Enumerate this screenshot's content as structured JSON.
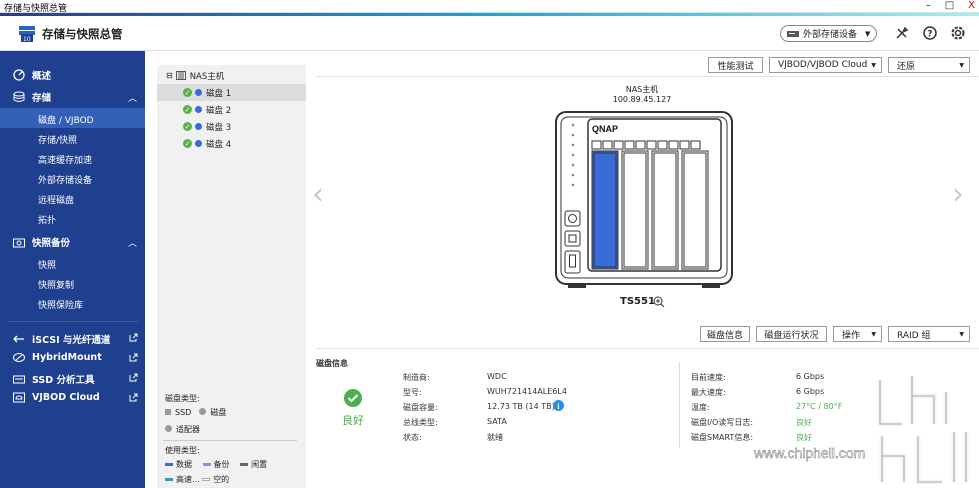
{
  "window": {
    "title": "存储与快照总管",
    "min": "–",
    "max": "□",
    "close": "X"
  },
  "header": {
    "title": "存储与快照总管",
    "ext_btn": "外部存储设备"
  },
  "sidebar": {
    "overview": "概述",
    "storage": "存储",
    "storage_items": [
      "磁盘 / VJBOD",
      "存储/快照",
      "高速缓存加速",
      "外部存储设备",
      "远程磁盘",
      "拓扑"
    ],
    "backup": "快照备份",
    "backup_items": [
      "快照",
      "快照复制",
      "快照保险库"
    ],
    "links": [
      "iSCSI 与光纤通道",
      "HybridMount",
      "SSD 分析工具",
      "VJBOD Cloud"
    ]
  },
  "tree": {
    "root": "NAS主机",
    "disks": [
      "磁盘 1",
      "磁盘 2",
      "磁盘 3",
      "磁盘 4"
    ]
  },
  "legend": {
    "disk_type_title": "磁盘类型:",
    "ssd": "SSD",
    "disk": "磁盘",
    "adapter": "适配器",
    "usage_title": "使用类型:",
    "data": "数据",
    "backup": "备份",
    "idle": "闲置",
    "cache": "高速...",
    "empty": "空的"
  },
  "toolbar": {
    "perf": "性能测试",
    "vjbod": "VJBOD/VJBOD Cloud",
    "restore": "还原"
  },
  "nas": {
    "name": "NAS主机",
    "ip": "100.89.45.127",
    "brand": "QNAP",
    "model": "TS551"
  },
  "actions": {
    "disk_info": "磁盘信息",
    "disk_status": "磁盘运行状况",
    "op": "操作",
    "raid": "RAID 组"
  },
  "disk_info": {
    "title": "磁盘信息",
    "health": "良好",
    "left": [
      {
        "label": "制造商:",
        "value": "WDC"
      },
      {
        "label": "型号:",
        "value": "WUH721414ALE6L4"
      },
      {
        "label": "磁盘容量:",
        "value": "12.73 TB (14 TB)"
      },
      {
        "label": "总线类型:",
        "value": "SATA"
      },
      {
        "label": "状态:",
        "value": "就绪"
      }
    ],
    "right": [
      {
        "label": "目前速度:",
        "value": "6 Gbps"
      },
      {
        "label": "最大速度:",
        "value": "6 Gbps"
      },
      {
        "label": "温度:",
        "value": "27°C / 80°F"
      },
      {
        "label": "磁盘I/O读写日志:",
        "value": "良好"
      },
      {
        "label": "磁盘SMART信息:",
        "value": "良好"
      }
    ]
  },
  "watermark": {
    "url": "www.chiphell.com"
  },
  "colors": {
    "sidebar": "#1f3f8f",
    "active": "#3560b8",
    "disk_selected": "#3a6bd6",
    "ok": "#4caf50"
  }
}
